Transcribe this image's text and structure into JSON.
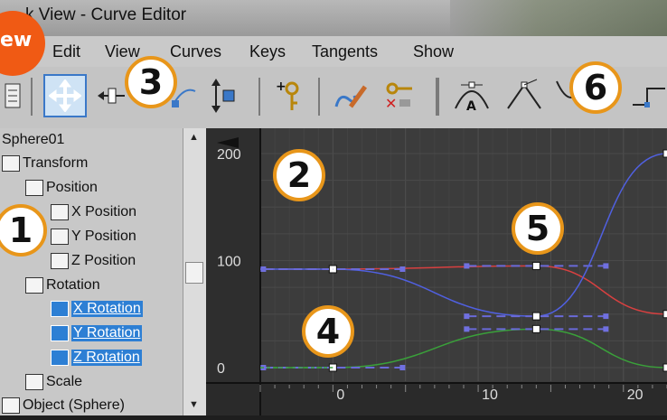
{
  "window": {
    "title": "k View - Curve Editor",
    "badge": "ew"
  },
  "menu": [
    "Edit",
    "View",
    "Curves",
    "Keys",
    "Tangents",
    "Show"
  ],
  "toolbar": {
    "tools": [
      "list-icon",
      "move-keys-icon",
      "slide-keys-icon",
      "scale-keys-icon",
      "scale-values-icon",
      "add-keys-icon",
      "draw-curves-icon",
      "reduce-keys-icon",
      "tangent-auto-icon",
      "tangent-custom-icon",
      "tangent-fast-icon",
      "tangent-slow-icon"
    ]
  },
  "tree": {
    "items": [
      {
        "label": "Sphere01",
        "selected": false
      },
      {
        "label": "Transform",
        "selected": false
      },
      {
        "label": "Position",
        "selected": false
      },
      {
        "label": "X Position",
        "selected": false
      },
      {
        "label": "Y Position",
        "selected": false
      },
      {
        "label": "Z Position",
        "selected": false
      },
      {
        "label": "Rotation",
        "selected": false
      },
      {
        "label": "X Rotation",
        "selected": true
      },
      {
        "label": "Y Rotation",
        "selected": true
      },
      {
        "label": "Z Rotation",
        "selected": true
      },
      {
        "label": "Scale",
        "selected": false
      },
      {
        "label": "Object (Sphere)",
        "selected": false
      }
    ]
  },
  "graph": {
    "y_ticks": [
      "200",
      "100",
      "0"
    ],
    "x_ticks": [
      "0",
      "10",
      "20"
    ],
    "y_range": [
      0,
      200
    ],
    "x_range": [
      -5,
      23
    ],
    "curves": [
      {
        "name": "X Rotation",
        "color": "#d84040",
        "keys": [
          [
            0,
            92
          ],
          [
            14,
            95
          ],
          [
            23,
            50
          ]
        ]
      },
      {
        "name": "Y Rotation",
        "color": "#5060e0",
        "keys": [
          [
            -5,
            92
          ],
          [
            0,
            92
          ],
          [
            14,
            48
          ],
          [
            23,
            200
          ]
        ]
      },
      {
        "name": "Z Rotation",
        "color": "#3aa03a",
        "keys": [
          [
            -5,
            0
          ],
          [
            0,
            0
          ],
          [
            14,
            36
          ],
          [
            23,
            0
          ]
        ]
      }
    ]
  },
  "callouts": [
    "1",
    "2",
    "3",
    "4",
    "5",
    "6"
  ],
  "colors": {
    "selection": "#2d7fd4",
    "callout_border": "#e8961a",
    "badge": "#f05a14"
  }
}
